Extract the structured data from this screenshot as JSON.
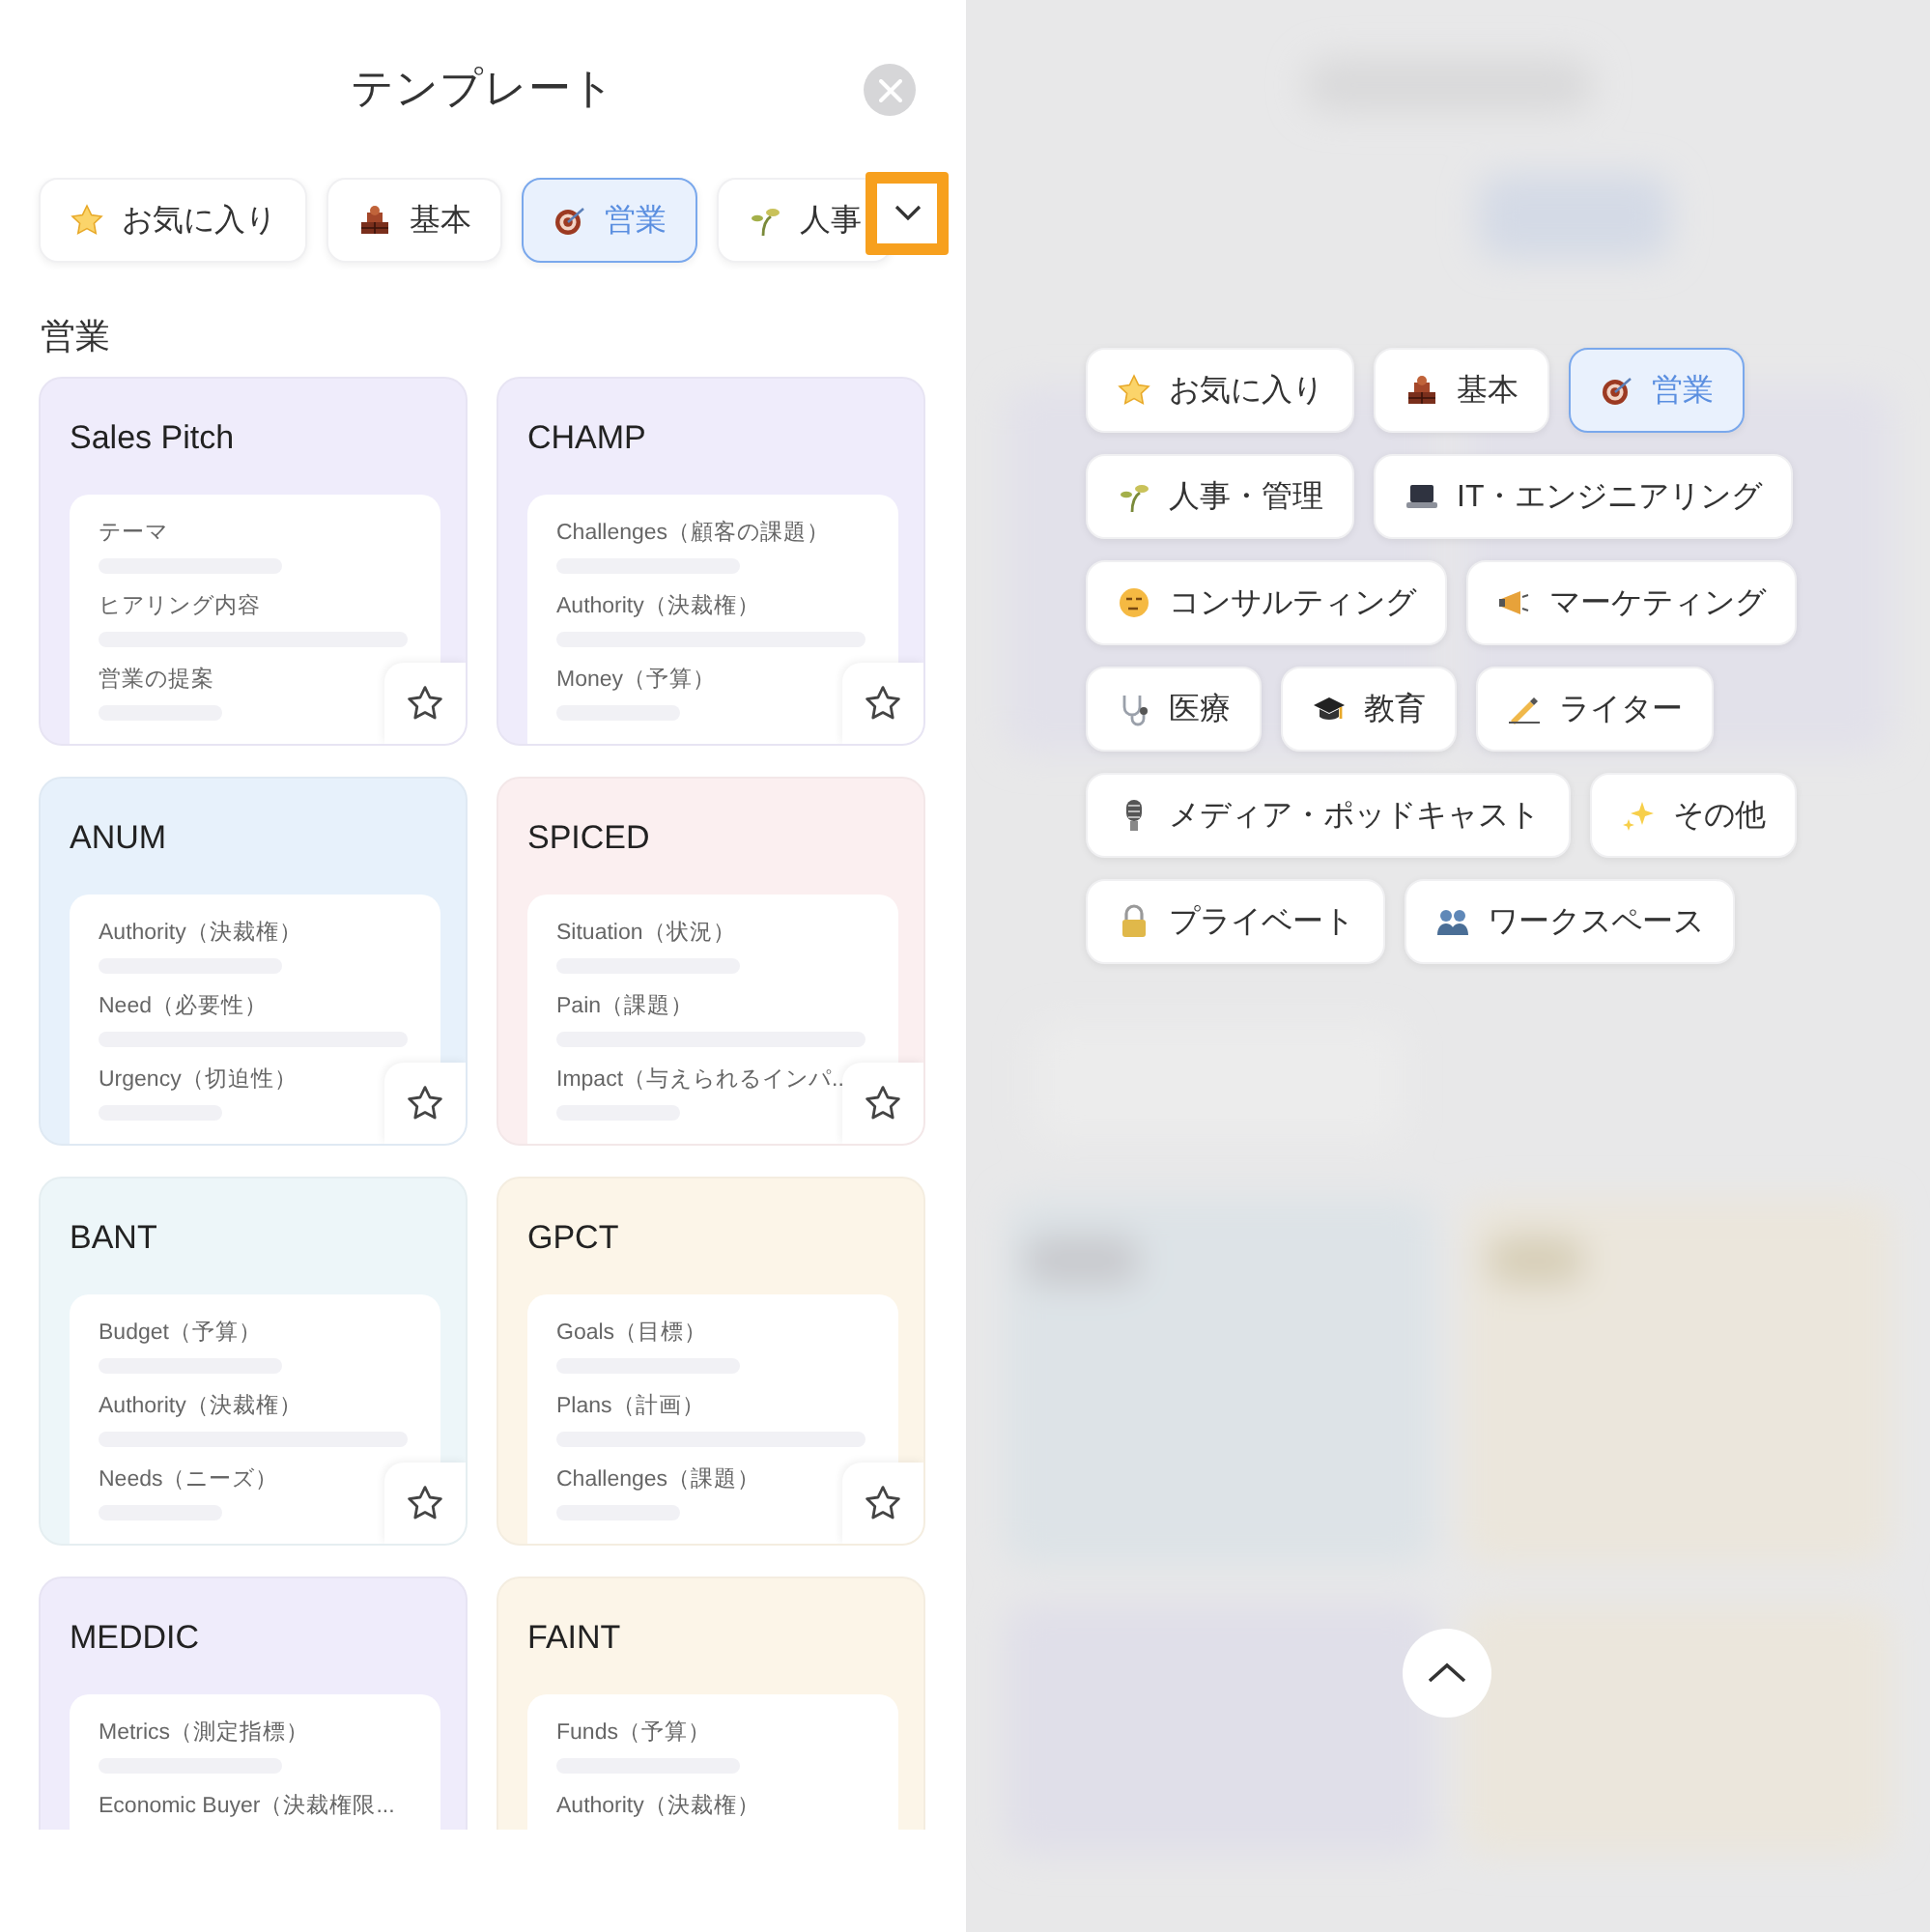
{
  "header": {
    "title": "テンプレート"
  },
  "category_bar": {
    "chips": [
      {
        "label": "お気に入り",
        "kind": "star",
        "selected": false
      },
      {
        "label": "基本",
        "kind": "bricks",
        "selected": false
      },
      {
        "label": "営業",
        "kind": "target",
        "selected": true
      },
      {
        "label": "人事",
        "kind": "sprout",
        "selected": false
      }
    ]
  },
  "section_title": "営業",
  "templates": [
    {
      "title": "Sales Pitch",
      "color": "#efecfb",
      "fields": [
        "テーマ",
        "ヒアリング内容",
        "営業の提案"
      ]
    },
    {
      "title": "CHAMP",
      "color": "#efecfb",
      "fields": [
        "Challenges（顧客の課題）",
        "Authority（決裁権）",
        "Money（予算）"
      ]
    },
    {
      "title": "ANUM",
      "color": "#e7f1fb",
      "fields": [
        "Authority（決裁権）",
        "Need（必要性）",
        "Urgency（切迫性）"
      ]
    },
    {
      "title": "SPICED",
      "color": "#fbeff0",
      "fields": [
        "Situation（状況）",
        "Pain（課題）",
        "Impact（与えられるインパ.."
      ]
    },
    {
      "title": "BANT",
      "color": "#edf6f9",
      "fields": [
        "Budget（予算）",
        "Authority（決裁権）",
        "Needs（ニーズ）"
      ]
    },
    {
      "title": "GPCT",
      "color": "#fcf5e8",
      "fields": [
        "Goals（目標）",
        "Plans（計画）",
        "Challenges（課題）"
      ]
    },
    {
      "title": "MEDDIC",
      "color": "#efecfb",
      "fields": [
        "Metrics（測定指標）",
        "Economic Buyer（決裁権限..."
      ]
    },
    {
      "title": "FAINT",
      "color": "#fcf5e8",
      "fields": [
        "Funds（予算）",
        "Authority（決裁権）"
      ]
    }
  ],
  "category_menu": {
    "chips": [
      {
        "label": "お気に入り",
        "kind": "star",
        "selected": false
      },
      {
        "label": "基本",
        "kind": "bricks",
        "selected": false
      },
      {
        "label": "営業",
        "kind": "target",
        "selected": true
      },
      {
        "label": "人事・管理",
        "kind": "sprout",
        "selected": false
      },
      {
        "label": "IT・エンジニアリング",
        "kind": "laptop",
        "selected": false
      },
      {
        "label": "コンサルティング",
        "kind": "face",
        "selected": false
      },
      {
        "label": "マーケティング",
        "kind": "megaphone",
        "selected": false
      },
      {
        "label": "医療",
        "kind": "stethoscope",
        "selected": false
      },
      {
        "label": "教育",
        "kind": "cap",
        "selected": false
      },
      {
        "label": "ライター",
        "kind": "pen",
        "selected": false
      },
      {
        "label": "メディア・ポッドキャスト",
        "kind": "microphone",
        "selected": false
      },
      {
        "label": "その他",
        "kind": "sparkles",
        "selected": false
      },
      {
        "label": "プライベート",
        "kind": "lock",
        "selected": false
      },
      {
        "label": "ワークスペース",
        "kind": "people",
        "selected": false
      }
    ]
  }
}
